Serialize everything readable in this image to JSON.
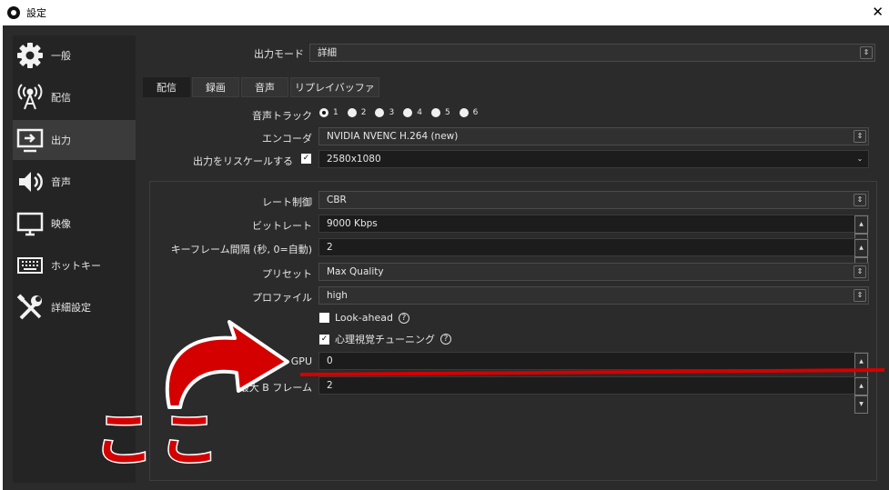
{
  "window": {
    "title": "設定",
    "close_glyph": "✕"
  },
  "sidebar": {
    "items": [
      {
        "label": "一般",
        "icon": "gear-icon",
        "active": false
      },
      {
        "label": "配信",
        "icon": "antenna-icon",
        "active": false
      },
      {
        "label": "出力",
        "icon": "output-monitor-icon",
        "active": true
      },
      {
        "label": "音声",
        "icon": "speaker-icon",
        "active": false
      },
      {
        "label": "映像",
        "icon": "monitor-icon",
        "active": false
      },
      {
        "label": "ホットキー",
        "icon": "keyboard-icon",
        "active": false
      },
      {
        "label": "詳細設定",
        "icon": "tools-icon",
        "active": false
      }
    ]
  },
  "output_mode": {
    "label": "出力モード",
    "value": "詳細"
  },
  "tabs": [
    {
      "label": "配信",
      "active": true
    },
    {
      "label": "録画",
      "active": false
    },
    {
      "label": "音声",
      "active": false
    },
    {
      "label": "リプレイバッファ",
      "active": false
    }
  ],
  "audio_track": {
    "label": "音声トラック",
    "options": [
      "1",
      "2",
      "3",
      "4",
      "5",
      "6"
    ],
    "selected": "1"
  },
  "encoder": {
    "label": "エンコーダ",
    "value": "NVIDIA NVENC H.264 (new)"
  },
  "rescale": {
    "label": "出力をリスケールする",
    "checked": true,
    "value": "2580x1080"
  },
  "encoder_settings": {
    "rate_control": {
      "label": "レート制御",
      "value": "CBR"
    },
    "bitrate": {
      "label": "ビットレート",
      "value": "9000 Kbps"
    },
    "keyframe": {
      "label": "キーフレーム間隔 (秒, 0=自動)",
      "value": "2"
    },
    "preset": {
      "label": "プリセット",
      "value": "Max Quality"
    },
    "profile": {
      "label": "プロファイル",
      "value": "high"
    },
    "lookahead": {
      "label": "Look-ahead",
      "checked": false
    },
    "psycho_visual": {
      "label": "心理視覚チューニング",
      "checked": true
    },
    "gpu": {
      "label": "GPU",
      "value": "0"
    },
    "max_bframes": {
      "label": "最大 B フレーム",
      "value": "2"
    }
  },
  "annotation": {
    "text": "ここ",
    "arrow_color": "#d40000",
    "underline_color": "#d40000"
  },
  "colors": {
    "background": "#2b2b2b",
    "sidebar": "#242424",
    "field": "#1c1c1c",
    "annotation": "#d40000"
  }
}
